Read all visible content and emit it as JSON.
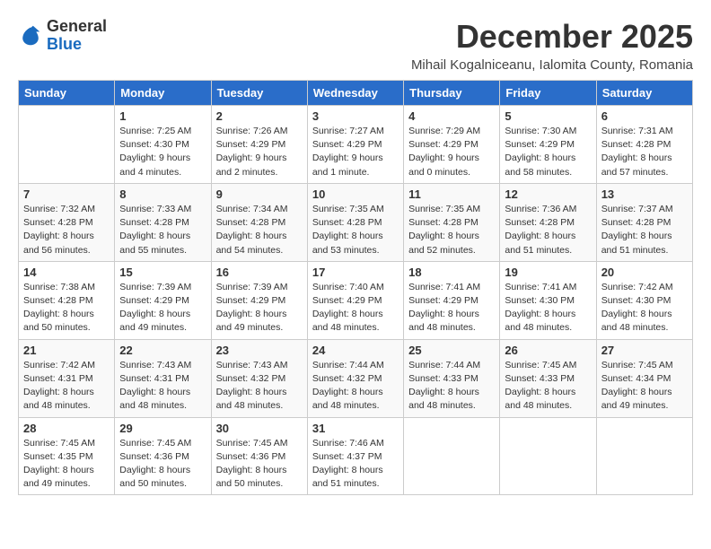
{
  "header": {
    "logo_general": "General",
    "logo_blue": "Blue",
    "month": "December 2025",
    "location": "Mihail Kogalniceanu, Ialomita County, Romania"
  },
  "weekdays": [
    "Sunday",
    "Monday",
    "Tuesday",
    "Wednesday",
    "Thursday",
    "Friday",
    "Saturday"
  ],
  "weeks": [
    [
      {
        "day": "",
        "info": ""
      },
      {
        "day": "1",
        "info": "Sunrise: 7:25 AM\nSunset: 4:30 PM\nDaylight: 9 hours\nand 4 minutes."
      },
      {
        "day": "2",
        "info": "Sunrise: 7:26 AM\nSunset: 4:29 PM\nDaylight: 9 hours\nand 2 minutes."
      },
      {
        "day": "3",
        "info": "Sunrise: 7:27 AM\nSunset: 4:29 PM\nDaylight: 9 hours\nand 1 minute."
      },
      {
        "day": "4",
        "info": "Sunrise: 7:29 AM\nSunset: 4:29 PM\nDaylight: 9 hours\nand 0 minutes."
      },
      {
        "day": "5",
        "info": "Sunrise: 7:30 AM\nSunset: 4:29 PM\nDaylight: 8 hours\nand 58 minutes."
      },
      {
        "day": "6",
        "info": "Sunrise: 7:31 AM\nSunset: 4:28 PM\nDaylight: 8 hours\nand 57 minutes."
      }
    ],
    [
      {
        "day": "7",
        "info": "Sunrise: 7:32 AM\nSunset: 4:28 PM\nDaylight: 8 hours\nand 56 minutes."
      },
      {
        "day": "8",
        "info": "Sunrise: 7:33 AM\nSunset: 4:28 PM\nDaylight: 8 hours\nand 55 minutes."
      },
      {
        "day": "9",
        "info": "Sunrise: 7:34 AM\nSunset: 4:28 PM\nDaylight: 8 hours\nand 54 minutes."
      },
      {
        "day": "10",
        "info": "Sunrise: 7:35 AM\nSunset: 4:28 PM\nDaylight: 8 hours\nand 53 minutes."
      },
      {
        "day": "11",
        "info": "Sunrise: 7:35 AM\nSunset: 4:28 PM\nDaylight: 8 hours\nand 52 minutes."
      },
      {
        "day": "12",
        "info": "Sunrise: 7:36 AM\nSunset: 4:28 PM\nDaylight: 8 hours\nand 51 minutes."
      },
      {
        "day": "13",
        "info": "Sunrise: 7:37 AM\nSunset: 4:28 PM\nDaylight: 8 hours\nand 51 minutes."
      }
    ],
    [
      {
        "day": "14",
        "info": "Sunrise: 7:38 AM\nSunset: 4:28 PM\nDaylight: 8 hours\nand 50 minutes."
      },
      {
        "day": "15",
        "info": "Sunrise: 7:39 AM\nSunset: 4:29 PM\nDaylight: 8 hours\nand 49 minutes."
      },
      {
        "day": "16",
        "info": "Sunrise: 7:39 AM\nSunset: 4:29 PM\nDaylight: 8 hours\nand 49 minutes."
      },
      {
        "day": "17",
        "info": "Sunrise: 7:40 AM\nSunset: 4:29 PM\nDaylight: 8 hours\nand 48 minutes."
      },
      {
        "day": "18",
        "info": "Sunrise: 7:41 AM\nSunset: 4:29 PM\nDaylight: 8 hours\nand 48 minutes."
      },
      {
        "day": "19",
        "info": "Sunrise: 7:41 AM\nSunset: 4:30 PM\nDaylight: 8 hours\nand 48 minutes."
      },
      {
        "day": "20",
        "info": "Sunrise: 7:42 AM\nSunset: 4:30 PM\nDaylight: 8 hours\nand 48 minutes."
      }
    ],
    [
      {
        "day": "21",
        "info": "Sunrise: 7:42 AM\nSunset: 4:31 PM\nDaylight: 8 hours\nand 48 minutes."
      },
      {
        "day": "22",
        "info": "Sunrise: 7:43 AM\nSunset: 4:31 PM\nDaylight: 8 hours\nand 48 minutes."
      },
      {
        "day": "23",
        "info": "Sunrise: 7:43 AM\nSunset: 4:32 PM\nDaylight: 8 hours\nand 48 minutes."
      },
      {
        "day": "24",
        "info": "Sunrise: 7:44 AM\nSunset: 4:32 PM\nDaylight: 8 hours\nand 48 minutes."
      },
      {
        "day": "25",
        "info": "Sunrise: 7:44 AM\nSunset: 4:33 PM\nDaylight: 8 hours\nand 48 minutes."
      },
      {
        "day": "26",
        "info": "Sunrise: 7:45 AM\nSunset: 4:33 PM\nDaylight: 8 hours\nand 48 minutes."
      },
      {
        "day": "27",
        "info": "Sunrise: 7:45 AM\nSunset: 4:34 PM\nDaylight: 8 hours\nand 49 minutes."
      }
    ],
    [
      {
        "day": "28",
        "info": "Sunrise: 7:45 AM\nSunset: 4:35 PM\nDaylight: 8 hours\nand 49 minutes."
      },
      {
        "day": "29",
        "info": "Sunrise: 7:45 AM\nSunset: 4:36 PM\nDaylight: 8 hours\nand 50 minutes."
      },
      {
        "day": "30",
        "info": "Sunrise: 7:45 AM\nSunset: 4:36 PM\nDaylight: 8 hours\nand 50 minutes."
      },
      {
        "day": "31",
        "info": "Sunrise: 7:46 AM\nSunset: 4:37 PM\nDaylight: 8 hours\nand 51 minutes."
      },
      {
        "day": "",
        "info": ""
      },
      {
        "day": "",
        "info": ""
      },
      {
        "day": "",
        "info": ""
      }
    ]
  ]
}
